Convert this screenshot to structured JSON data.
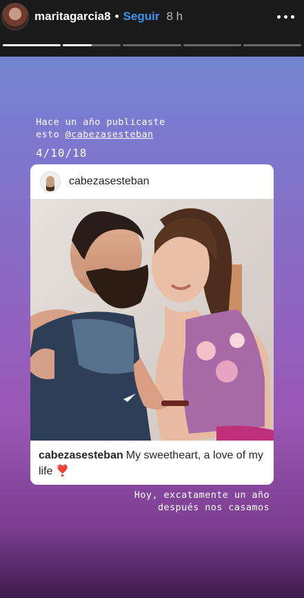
{
  "header": {
    "username": "maritagarcia8",
    "separator": "•",
    "follow_label": "Seguir",
    "time": "8 h",
    "avatar_icon": "profile-avatar",
    "more_icon": "more-dots-icon"
  },
  "progress": {
    "segments": [
      1.0,
      0.5,
      0.0,
      0.0,
      0.0
    ]
  },
  "memory": {
    "line1": "Hace un año publicaste",
    "line2_prefix": "esto ",
    "mention": "@cabezasesteban",
    "date": "4/10/18"
  },
  "post": {
    "username": "cabezasesteban",
    "caption_user": "cabezasesteban",
    "caption_text": "My sweetheart, a love of my life",
    "heart_glyph": "❣️"
  },
  "bottom": {
    "line1": "Hoy, excatamente un año",
    "line2": "después nos casamos"
  },
  "colors": {
    "follow": "#3897f0",
    "story_top": "#6d8fd0",
    "story_bottom": "#7c3e92"
  }
}
